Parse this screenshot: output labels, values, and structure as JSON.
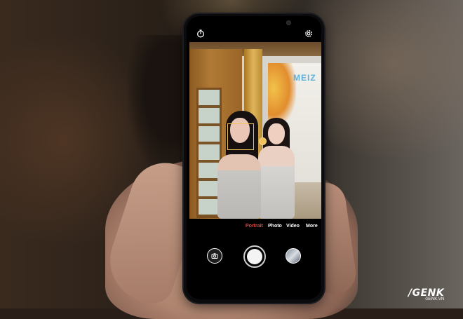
{
  "camera_app": {
    "top_bar": {
      "left_icon": "timer-icon",
      "right_icon": "settings-icon"
    },
    "viewfinder": {
      "sign_text": "MEIZ"
    },
    "modes": [
      {
        "label": "Portrait",
        "active": true
      },
      {
        "label": "Photo",
        "active": false
      },
      {
        "label": "Video",
        "active": false
      },
      {
        "label": "More",
        "active": false
      }
    ],
    "controls": {
      "gallery_icon": "gallery-icon",
      "shutter_icon": "shutter-button",
      "switch_icon": "switch-camera-icon"
    },
    "colors": {
      "active_mode": "#e8453c",
      "focus_box": "#f0c25a"
    }
  },
  "watermark": {
    "brand": "/GENK",
    "domain": "GENK.VN"
  }
}
